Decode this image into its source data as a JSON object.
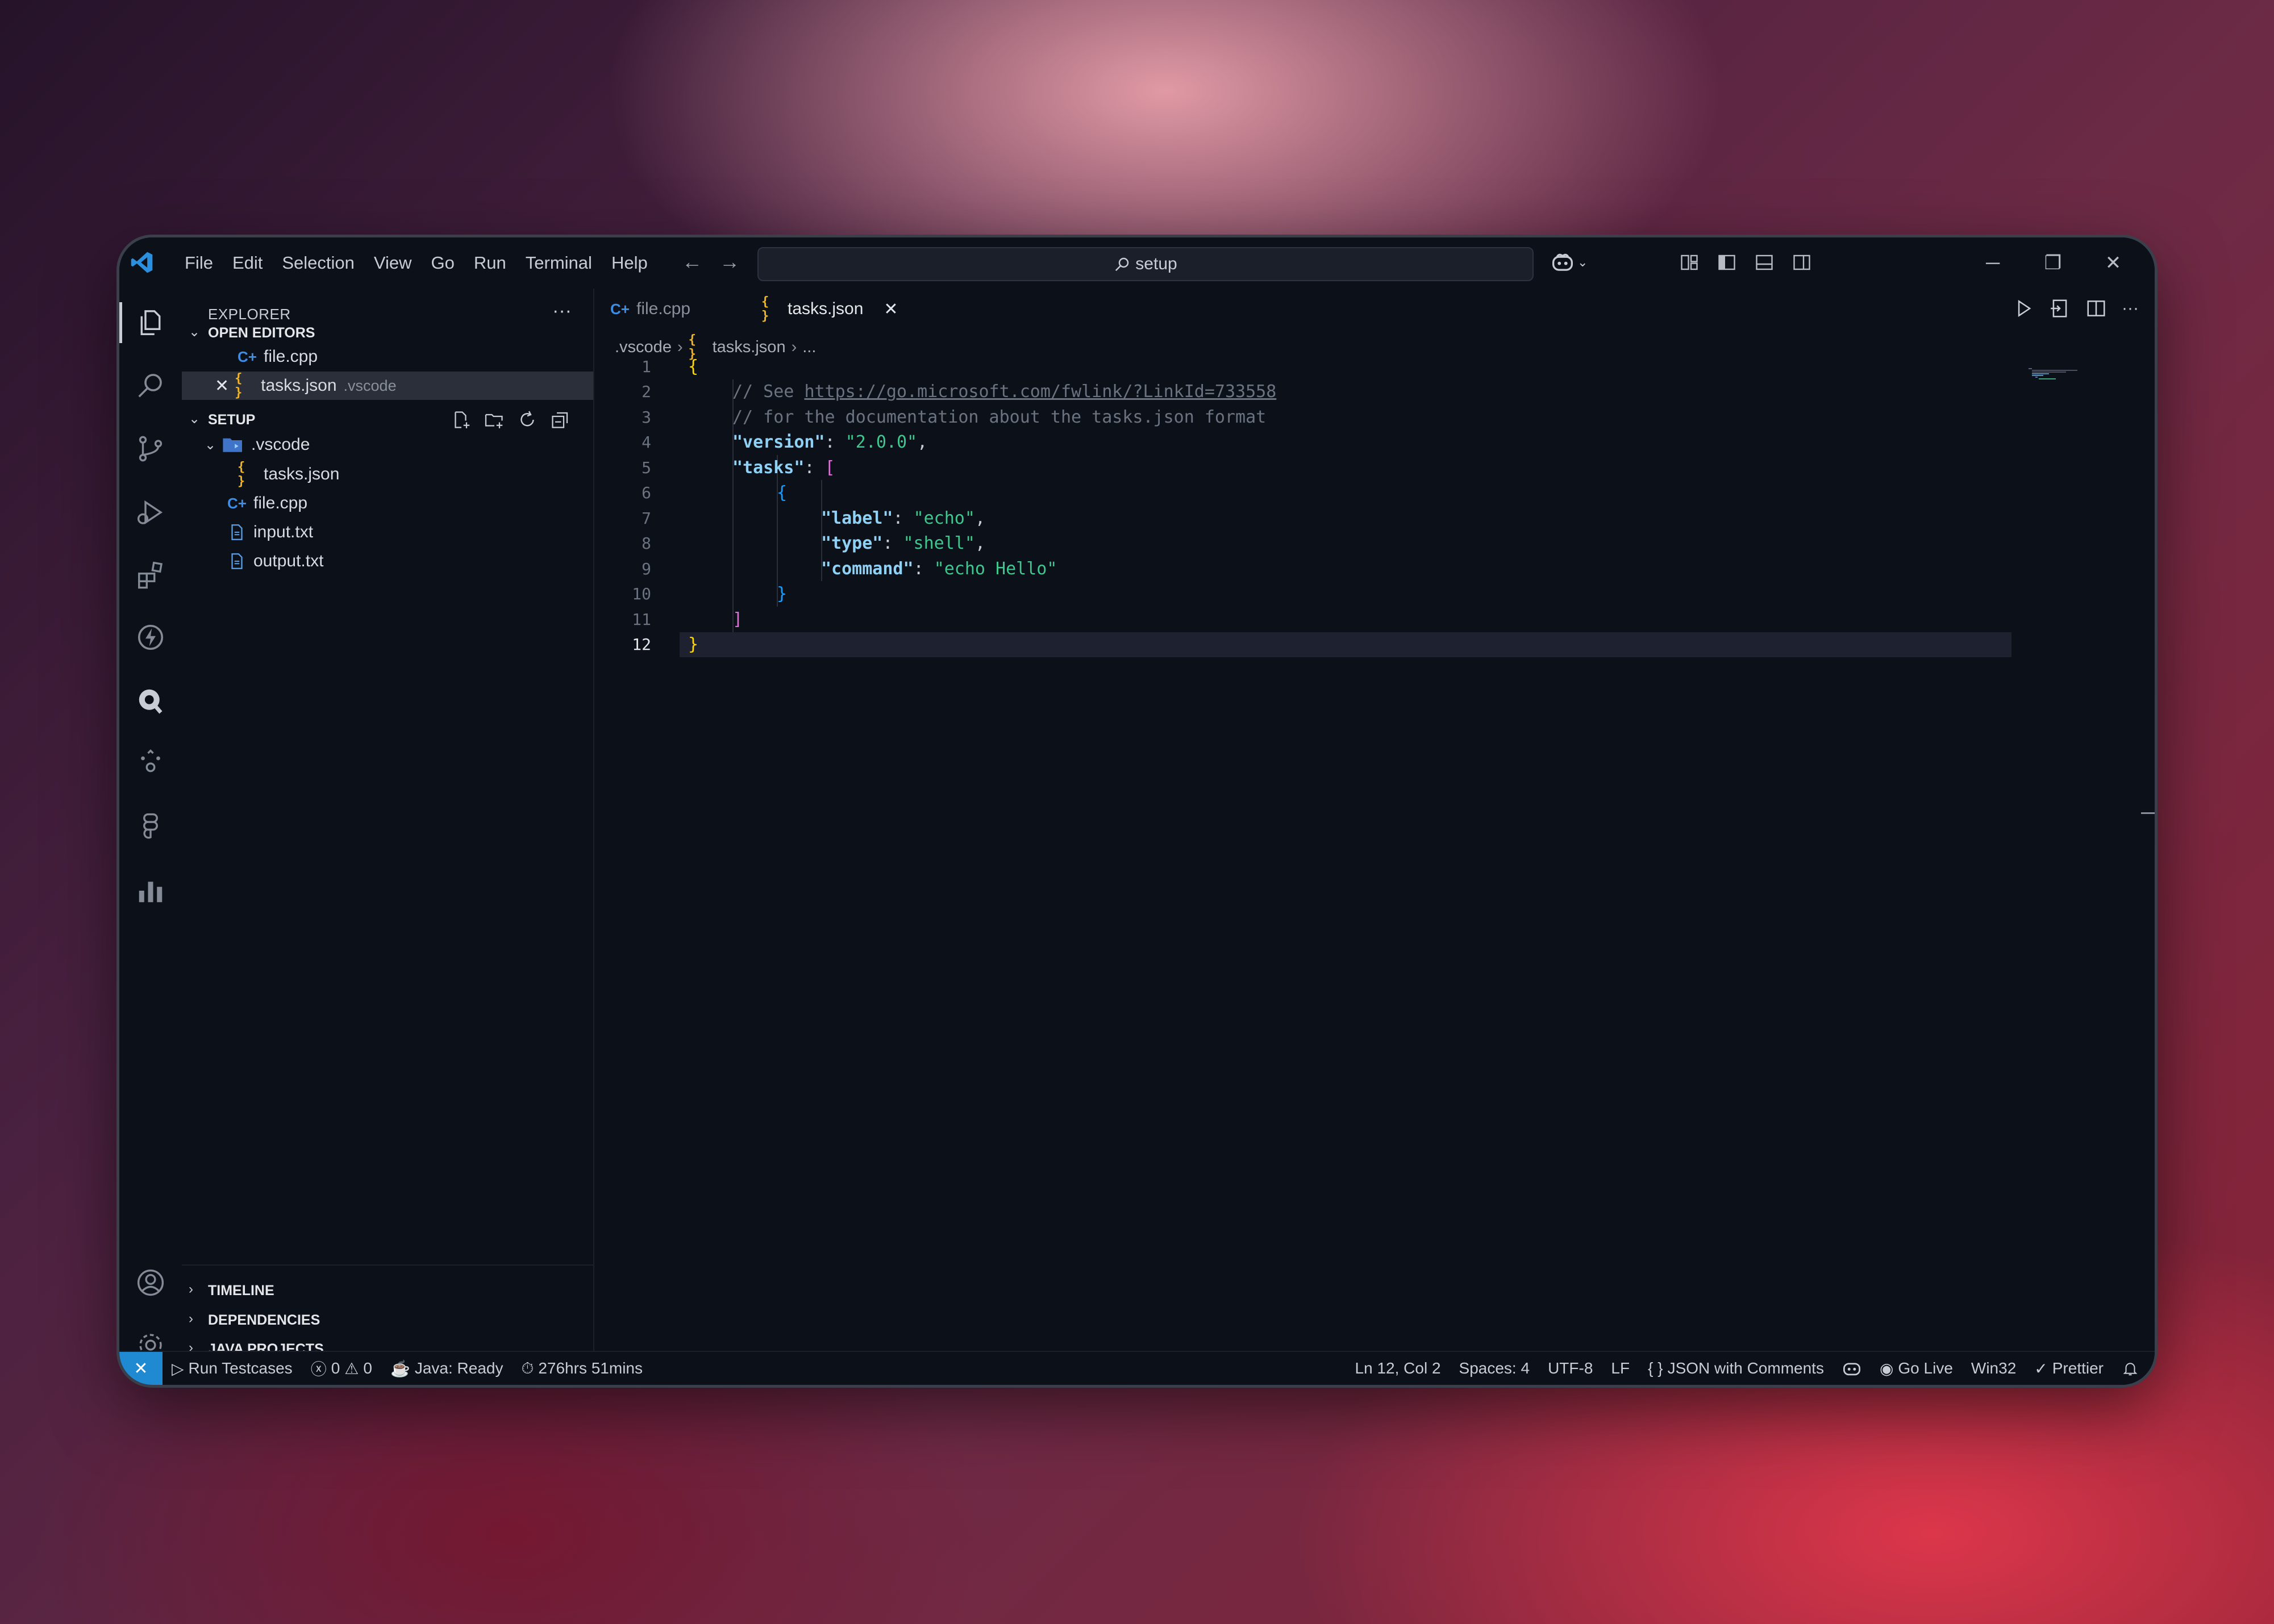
{
  "titlebar": {
    "menu": [
      "File",
      "Edit",
      "Selection",
      "View",
      "Go",
      "Run",
      "Terminal",
      "Help"
    ],
    "search_text": "setup",
    "window_controls": [
      "minimize",
      "restore",
      "close"
    ]
  },
  "activity_bar": [
    "explorer-icon",
    "search-icon",
    "source-control-icon",
    "run-debug-icon",
    "extensions-icon",
    "lightning-icon",
    "quokka-icon",
    "docker-icon",
    "figma-icon",
    "chart-icon",
    "account-icon",
    "settings-icon"
  ],
  "sidebar": {
    "header": "EXPLORER",
    "more": "···",
    "open_editors": {
      "title": "OPEN EDITORS",
      "items": [
        {
          "name": "file.cpp",
          "folder": ""
        },
        {
          "name": "tasks.json",
          "folder": ".vscode"
        }
      ]
    },
    "setup": {
      "title": "SETUP",
      "tree": [
        {
          "name": ".vscode",
          "type": "folder"
        },
        {
          "name": "tasks.json",
          "type": "json"
        },
        {
          "name": "file.cpp",
          "type": "cpp"
        },
        {
          "name": "input.txt",
          "type": "txt"
        },
        {
          "name": "output.txt",
          "type": "txt"
        }
      ]
    },
    "bottom_sections": [
      "TIMELINE",
      "DEPENDENCIES",
      "JAVA PROJECTS"
    ]
  },
  "editor": {
    "tabs": [
      {
        "label": "file.cpp",
        "active": false
      },
      {
        "label": "tasks.json",
        "active": true
      }
    ],
    "breadcrumb": [
      ".vscode",
      "tasks.json",
      "..."
    ],
    "line_numbers": [
      "1",
      "2",
      "3",
      "4",
      "5",
      "6",
      "7",
      "8",
      "9",
      "10",
      "11",
      "12"
    ],
    "current_line": 12,
    "code": {
      "l1_open": "{",
      "l2_prefix": "// See ",
      "l2_link": "https://go.microsoft.com/fwlink/?LinkId=733558",
      "l3": "// for the documentation about the tasks.json format",
      "l4_key": "\"version\"",
      "l4_val": "\"2.0.0\"",
      "l5_key": "\"tasks\"",
      "l5_open": "[",
      "l6_open": "{",
      "l7_key": "\"label\"",
      "l7_val": "\"echo\"",
      "l8_key": "\"type\"",
      "l8_val": "\"shell\"",
      "l9_key": "\"command\"",
      "l9_val": "\"echo Hello\"",
      "l10_close": "}",
      "l11_close": "]",
      "l12_close": "}"
    }
  },
  "statusbar": {
    "left": {
      "run_testcases": "Run Testcases",
      "errors": "0",
      "warnings": "0",
      "java": "Java: Ready",
      "time": "276hrs 51mins"
    },
    "right": {
      "position": "Ln 12, Col 2",
      "spaces": "Spaces: 4",
      "encoding": "UTF-8",
      "eol": "LF",
      "language": "JSON with Comments",
      "golive": "Go Live",
      "platform": "Win32",
      "prettier": "Prettier"
    }
  },
  "colors": {
    "background": "#0c1019",
    "accent": "#1f8ad2",
    "json_key": "#8fd0f5",
    "json_string": "#3fc78f",
    "comment": "#6b7380"
  }
}
